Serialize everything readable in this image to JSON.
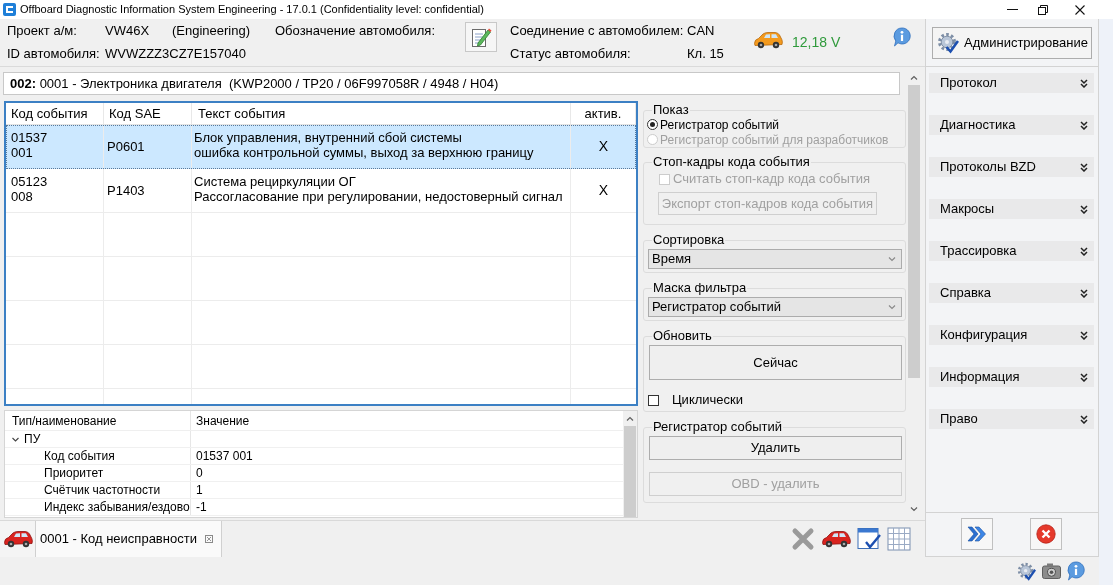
{
  "window": {
    "title": "Offboard Diagnostic Information System Engineering - 17.0.1 (Confidentiality level: confidential)"
  },
  "vehicle": {
    "project_label": "Проект а/м:",
    "project": "VW46X",
    "project_kind": "(Engineering)",
    "designation_label": "Обозначение автомобиля:",
    "id_label": "ID автомобиля:",
    "id": "WVWZZZ3CZ7E157040"
  },
  "connection": {
    "connection_label": "Соединение с автомобилем:",
    "connection": "CAN",
    "status_label": "Статус автомобиля:",
    "status": "Кл. 15",
    "voltage": "12,18 V"
  },
  "sidebar": {
    "admin_button": "Администрирование",
    "items": [
      {
        "label": "Протокол",
        "expanded": false
      },
      {
        "label": "Диагностика",
        "expanded": false
      },
      {
        "label": "Протоколы BZD",
        "expanded": false
      },
      {
        "label": "Макросы",
        "expanded": false
      },
      {
        "label": "Трассировка",
        "expanded": false
      },
      {
        "label": "Справка",
        "expanded": false
      },
      {
        "label": "Конфигурация",
        "expanded": false
      },
      {
        "label": "Информация",
        "expanded": false
      },
      {
        "label": "Право",
        "expanded": false
      }
    ]
  },
  "module": {
    "text": "**002:** 0001 - Электроника двигателя  (KWP2000 / TP20 / 06F997058R / 4948 / H04)"
  },
  "events_table": {
    "columns": [
      "Код события",
      "Код SAE",
      "Текст события",
      "актив."
    ],
    "rows": [
      {
        "code": [
          "01537",
          "001"
        ],
        "sae": "P0601",
        "text": [
          "Блок управления, внутренний сбой системы",
          "ошибка контрольной суммы, выход за верхнюю границу"
        ],
        "active": "X",
        "selected": true
      },
      {
        "code": [
          "05123",
          "008"
        ],
        "sae": "P1403",
        "text": [
          "Система рециркуляции ОГ",
          "Рассогласование при регулировании, недостоверный сигнал"
        ],
        "active": "X",
        "selected": false
      }
    ]
  },
  "details": {
    "columns": [
      "Тип/наименование",
      "Значение"
    ],
    "tree": [
      {
        "name": "ПУ",
        "expanded": true,
        "children": [
          {
            "name": "Код события",
            "value": "01537 001"
          },
          {
            "name": "Приоритет",
            "value": "0"
          },
          {
            "name": "Счётчик частотности",
            "value": "1"
          },
          {
            "name": "Индекс забывания/ездово",
            "value": "-1"
          }
        ]
      }
    ]
  },
  "display": {
    "title": "Показ",
    "options": [
      {
        "label": "Регистратор событий",
        "selected": true,
        "disabled": false
      },
      {
        "label": "Регистратор событий для разработчиков",
        "selected": false,
        "disabled": true
      }
    ]
  },
  "freeze_frames": {
    "title": "Стоп-кадры кода события",
    "checkbox": {
      "label": "Считать стоп-кадр кода события",
      "checked": false,
      "disabled": true
    },
    "button": {
      "label": "Экспорт стоп-кадров кода события",
      "disabled": true
    }
  },
  "sorting": {
    "title": "Сортировка",
    "value": "Время"
  },
  "filter_mask": {
    "title": "Маска фильтра",
    "value": "Регистратор событий"
  },
  "refresh": {
    "title": "Обновить",
    "button": "Сейчас",
    "cyclic": {
      "label": "Циклически",
      "checked": false
    }
  },
  "event_memory": {
    "title": "Регистратор событий",
    "buttons": [
      {
        "label": "Удалить",
        "disabled": false
      },
      {
        "label": "OBD - удалить",
        "disabled": true
      }
    ]
  },
  "tabs": [
    {
      "label": "0001 - Код неисправности",
      "selected": true
    }
  ]
}
